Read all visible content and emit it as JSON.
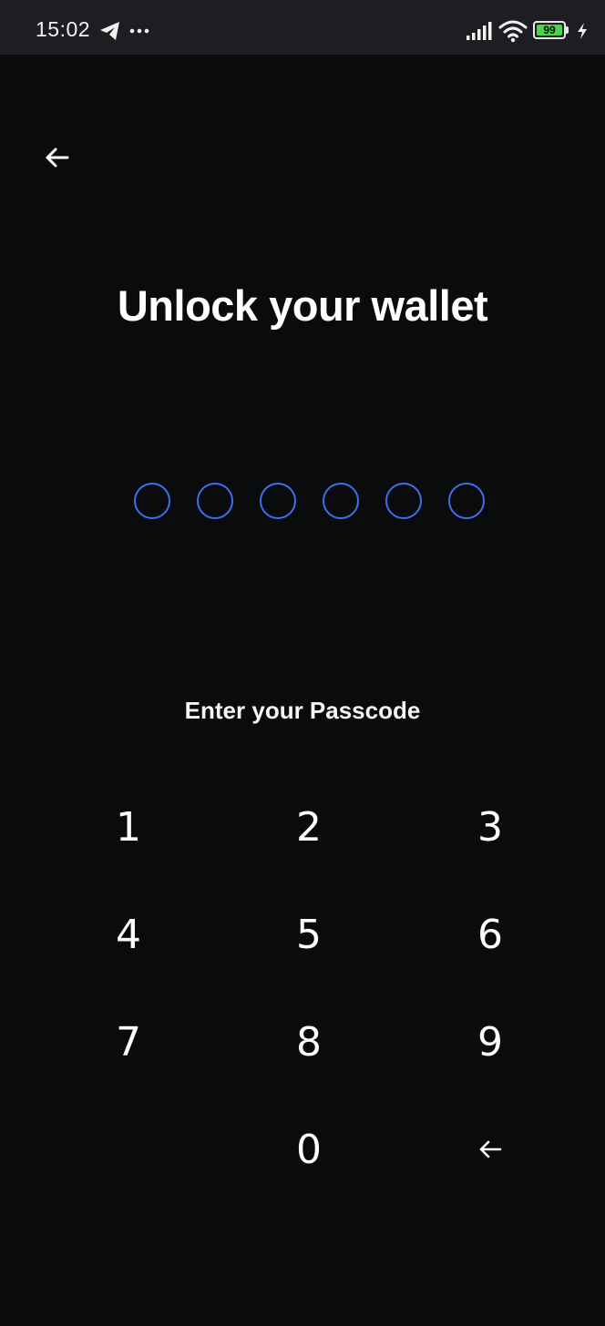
{
  "status_bar": {
    "time": "15:02",
    "battery_level": "99",
    "icons": [
      "telegram-icon",
      "more-icon",
      "signal-icon",
      "wifi-icon",
      "battery-icon",
      "charging-bolt-icon"
    ]
  },
  "header": {
    "back_icon": "arrow-left-icon"
  },
  "title": "Unlock your wallet",
  "passcode": {
    "length": 6,
    "filled": 0,
    "dot_color": "#3d6ff0"
  },
  "prompt": "Enter your Passcode",
  "keypad": {
    "keys": [
      "1",
      "2",
      "3",
      "4",
      "5",
      "6",
      "7",
      "8",
      "9",
      "",
      "0",
      "backspace-icon"
    ]
  },
  "colors": {
    "background": "#0a0b0d",
    "status_bar": "#1d1e22",
    "accent": "#3d6ff0",
    "battery": "#4cd44a",
    "text": "#ffffff"
  }
}
